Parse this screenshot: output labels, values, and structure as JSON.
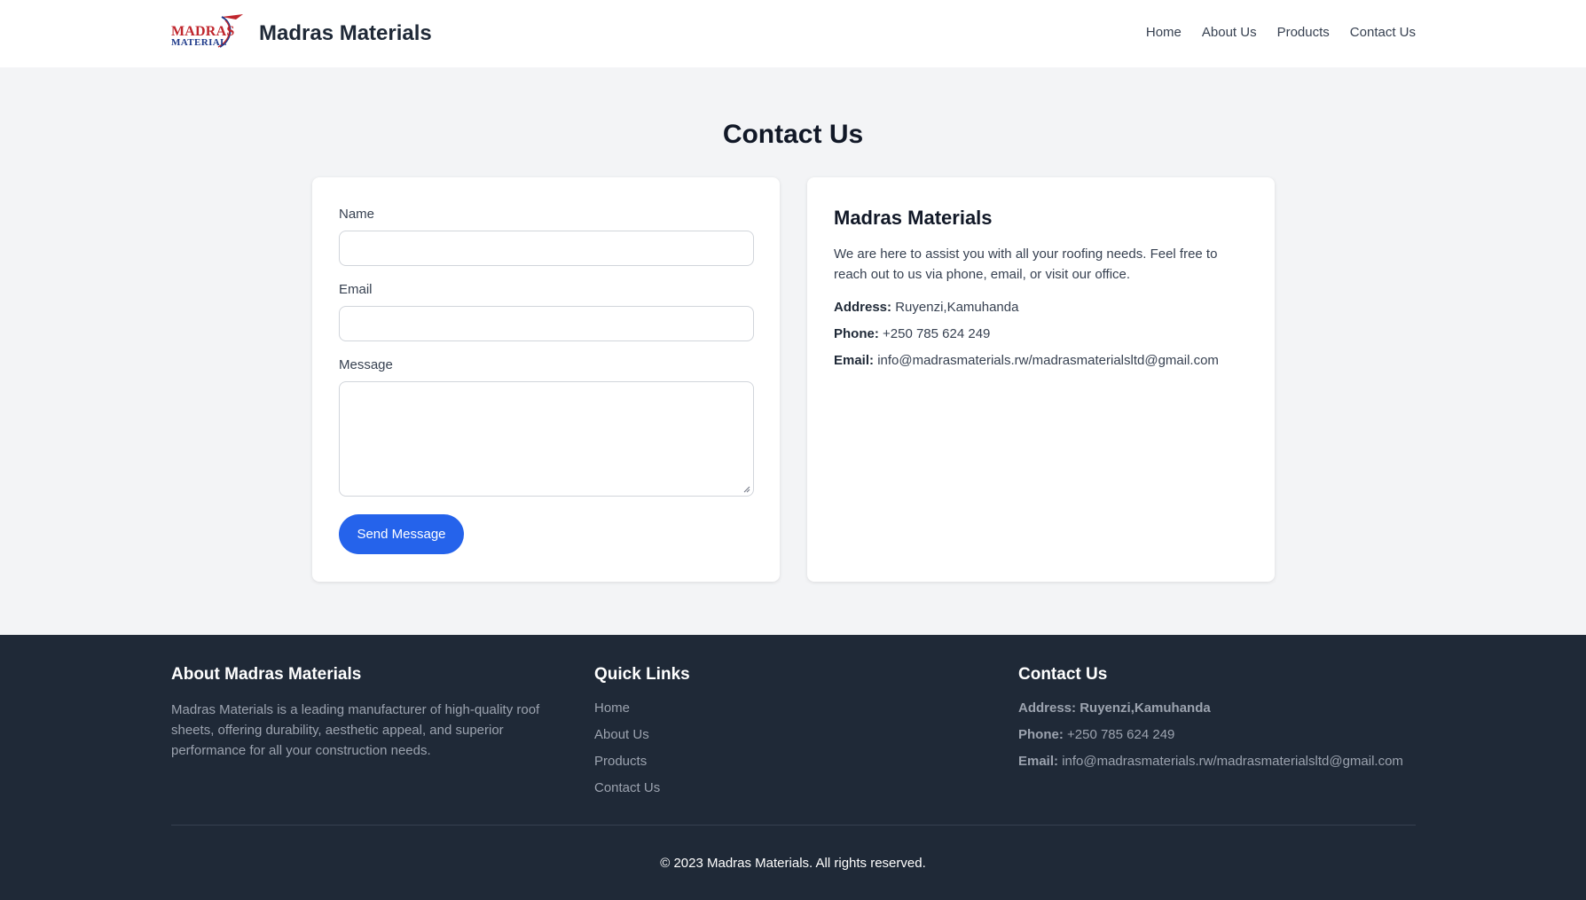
{
  "header": {
    "logo_word1": "MADRAS",
    "logo_word2": "MATERIAL",
    "brand_name": "Madras Materials",
    "nav": [
      "Home",
      "About Us",
      "Products",
      "Contact Us"
    ]
  },
  "page": {
    "title": "Contact Us"
  },
  "form": {
    "name_label": "Name",
    "name_value": "",
    "email_label": "Email",
    "email_value": "",
    "message_label": "Message",
    "message_value": "",
    "submit_label": "Send Message"
  },
  "info": {
    "title": "Madras Materials",
    "description": "We are here to assist you with all your roofing needs. Feel free to reach out to us via phone, email, or visit our office.",
    "address_label": "Address:",
    "address_value": "Ruyenzi,Kamuhanda",
    "phone_label": "Phone:",
    "phone_value": "+250 785 624 249",
    "email_label": "Email:",
    "email_value": "info@madrasmaterials.rw/madrasmaterialsltd@gmail.com"
  },
  "footer": {
    "about_title": "About Madras Materials",
    "about_text": "Madras Materials is a leading manufacturer of high-quality roof sheets, offering durability, aesthetic appeal, and superior performance for all your construction needs.",
    "links_title": "Quick Links",
    "links": [
      "Home",
      "About Us",
      "Products",
      "Contact Us"
    ],
    "contact_title": "Contact Us",
    "address_label": "Address:",
    "address_value": "Ruyenzi,Kamuhanda",
    "phone_label": "Phone:",
    "phone_value": "+250 785 624 249",
    "email_label": "Email:",
    "email_value": "info@madrasmaterials.rw/madrasmaterialsltd@gmail.com",
    "copyright": "© 2023 Madras Materials. All rights reserved."
  },
  "colors": {
    "primary": "#2563eb",
    "footer_bg": "#1f2937",
    "page_bg": "#f3f4f6",
    "logo_red": "#c0262d",
    "logo_blue": "#1e3a8a"
  },
  "icons": [
    "logo-swoosh-icon",
    "textarea-resize-icon"
  ]
}
